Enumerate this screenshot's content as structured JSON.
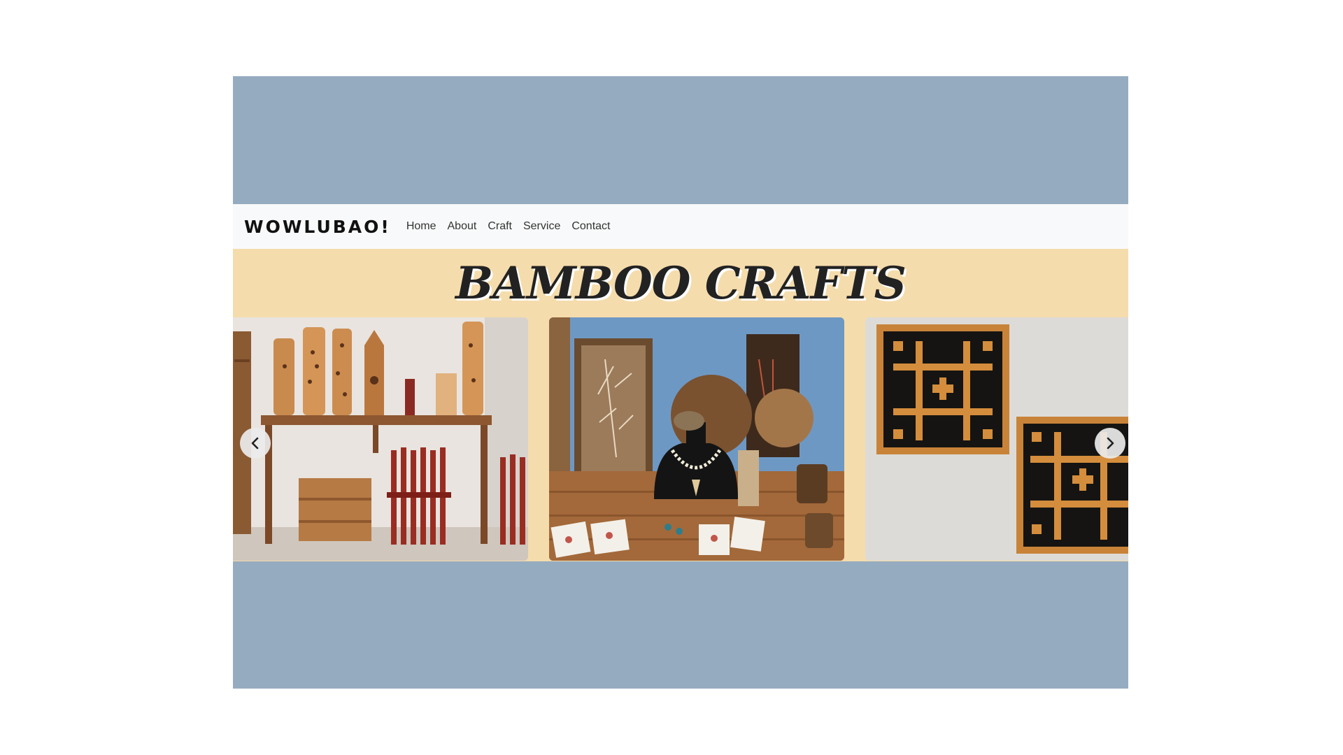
{
  "navbar": {
    "brand": "WOWLUBAO!",
    "links": [
      "Home",
      "About",
      "Craft",
      "Service",
      "Contact"
    ]
  },
  "hero": {
    "title": "BAMBOO CRAFTS"
  },
  "carousel": {
    "slides": [
      {
        "subject": "bamboo lamps and wooden table"
      },
      {
        "subject": "bamboo jewelry and trays display"
      },
      {
        "subject": "bamboo lattice wall panels"
      }
    ],
    "prev_icon": "chevron-left-icon",
    "next_icon": "chevron-right-icon"
  },
  "colors": {
    "frame": "#95abc0",
    "navbar": "#f8f9fa",
    "hero": "#f5dcac"
  }
}
